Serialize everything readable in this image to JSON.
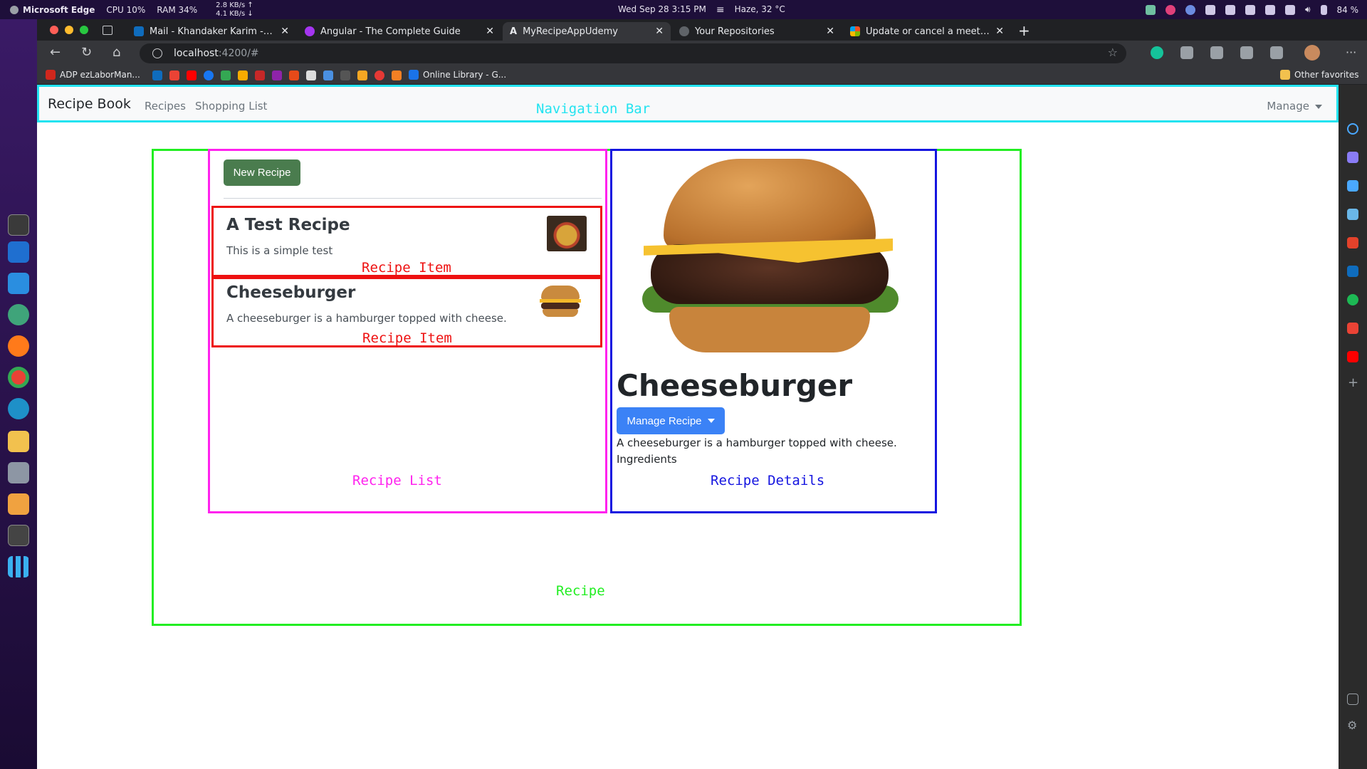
{
  "os": {
    "app_name": "Microsoft Edge",
    "cpu": "CPU   10%",
    "ram": "RAM   34%",
    "net_up": "2.8 KB/s  ↑",
    "net_down": "4.1 KB/s  ↓",
    "datetime": "Wed Sep 28   3:15 PM",
    "weather": "Haze, 32 °C",
    "battery": "84 %"
  },
  "browser": {
    "tabs": [
      {
        "title": "Mail - Khandaker Karim - Out",
        "icon": "outlook-icon",
        "color": "#0f6cbd"
      },
      {
        "title": "Angular - The Complete Guide",
        "icon": "udemy-icon",
        "color": "#a435f0"
      },
      {
        "title": "MyRecipeAppUdemy",
        "icon": "angular-icon",
        "color": "#e8eaed"
      },
      {
        "title": "Your Repositories",
        "icon": "github-icon",
        "color": "#5f6368"
      },
      {
        "title": "Update or cancel a meeting y",
        "icon": "microsoft-icon",
        "color": "#f25022"
      }
    ],
    "new_tab": "+",
    "close_glyph": "✕",
    "url_host": "localhost",
    "url_rest": ":4200/#",
    "favorites": [
      {
        "label": "ADP ezLaborMan...",
        "color": "#d0271d"
      },
      {
        "label": "Online Library - G...",
        "color": "#1a73e8"
      }
    ],
    "other_favorites": "Other favorites"
  },
  "app": {
    "brand": "Recipe Book",
    "nav": {
      "recipes": "Recipes",
      "shopping_list": "Shopping List",
      "manage": "Manage"
    },
    "list": {
      "new_recipe": "New Recipe",
      "items": [
        {
          "name": "A Test Recipe",
          "description": "This is a simple test"
        },
        {
          "name": "Cheeseburger",
          "description": "A cheeseburger is a hamburger topped with cheese."
        }
      ]
    },
    "detail": {
      "name": "Cheeseburger",
      "manage_button": "Manage Recipe",
      "description": "A cheeseburger is a hamburger topped with cheese.",
      "ingredients_label": "Ingredients"
    }
  },
  "annotations": {
    "navigation_bar": "Navigation Bar",
    "recipe_item": "Recipe Item",
    "recipe_list": "Recipe List",
    "recipe_details": "Recipe Details",
    "recipe": "Recipe"
  },
  "colors": {
    "nav_box": "#22e3f0",
    "recipe_box": "#22ee22",
    "list_box": "#ff22ee",
    "item_box": "#ee1111",
    "details_box": "#1515e0",
    "new_recipe_btn": "#4a7c4e",
    "manage_recipe_btn": "#3b82f6"
  }
}
